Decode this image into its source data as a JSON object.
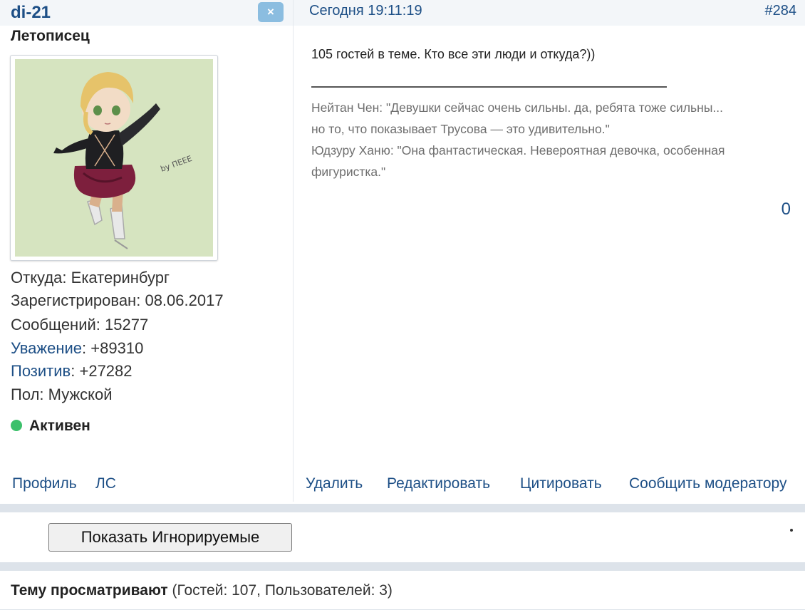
{
  "user": {
    "name": "di-21",
    "close_label": "×",
    "rank": "Летописец",
    "avatar_signature": "by ПЕЕЕ",
    "info": {
      "from_label": "Откуда:",
      "from_value": "Екатеринбург",
      "registered_label": "Зарегистрирован:",
      "registered_value": "08.06.2017",
      "messages_label": "Сообщений:",
      "messages_value": "15277",
      "respect_label": "Уважение",
      "respect_value": "+89310",
      "positive_label": "Позитив",
      "positive_value": "+27282",
      "gender_label": "Пол:",
      "gender_value": "Мужской"
    },
    "status": "Активен",
    "status_color": "#3cc06b",
    "links": {
      "profile": "Профиль",
      "pm": "ЛС"
    }
  },
  "post": {
    "date": "Сегодня 19:11:19",
    "number": "#284",
    "text": "105 гостей в теме. Кто все эти люди и откуда?))",
    "signature": [
      "Нейтан Чен: \"Девушки сейчас очень сильны. да, ребята тоже сильны...",
      "но то, что показывает Трусова — это удивительно.\"",
      "Юдзуру Ханю: \"Она фантастическая. Невероятная девочка, особенная",
      "фигуристка.\""
    ],
    "count": "0",
    "actions": {
      "delete": "Удалить",
      "edit": "Редактировать",
      "quote": "Цитировать",
      "report": "Сообщить модератору"
    }
  },
  "ignore_button": "Показать Игнорируемые",
  "viewers": {
    "label": "Тему просматривают",
    "detail": "(Гостей: 107, Пользователей: 3)"
  },
  "colors": {
    "link": "#1d4f86",
    "header_bg": "#f3f6f9",
    "close_bg": "#8bbde0"
  }
}
